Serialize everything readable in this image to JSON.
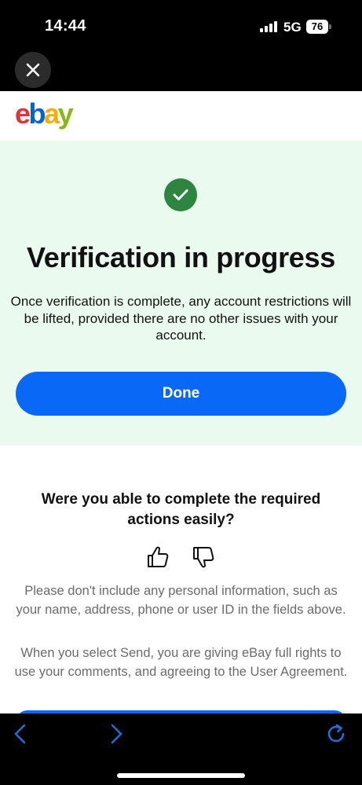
{
  "status_bar": {
    "time": "14:44",
    "network": "5G",
    "battery": "76"
  },
  "top_bar": {
    "close_icon": "close-icon"
  },
  "logo": {
    "letters": [
      "e",
      "b",
      "a",
      "y"
    ],
    "colors": [
      "#e53238",
      "#0064d2",
      "#f5af02",
      "#86b817"
    ]
  },
  "banner": {
    "icon": "checkmark-icon",
    "title": "Verification in progress",
    "message": "Once verification is complete, any account restrictions will be lifted, provided there are no other issues with your account.",
    "done_label": "Done"
  },
  "feedback": {
    "question": "Were you able to complete the required actions easily?",
    "thumbs_up_icon": "thumbs-up-icon",
    "thumbs_down_icon": "thumbs-down-icon",
    "privacy_note": "Please don't include any personal information, such as your name, address, phone or user ID in the fields above.",
    "rights_note": "When you select Send, you are giving eBay full rights to use your comments, and agreeing to the User Agreement."
  },
  "browser_bar": {
    "back_icon": "chevron-left-icon",
    "forward_icon": "chevron-right-icon",
    "reload_icon": "reload-icon"
  },
  "colors": {
    "accent": "#0968f6",
    "success": "#2e8540",
    "banner_bg": "#ebfaef",
    "muted_text": "#6b6b6b"
  }
}
